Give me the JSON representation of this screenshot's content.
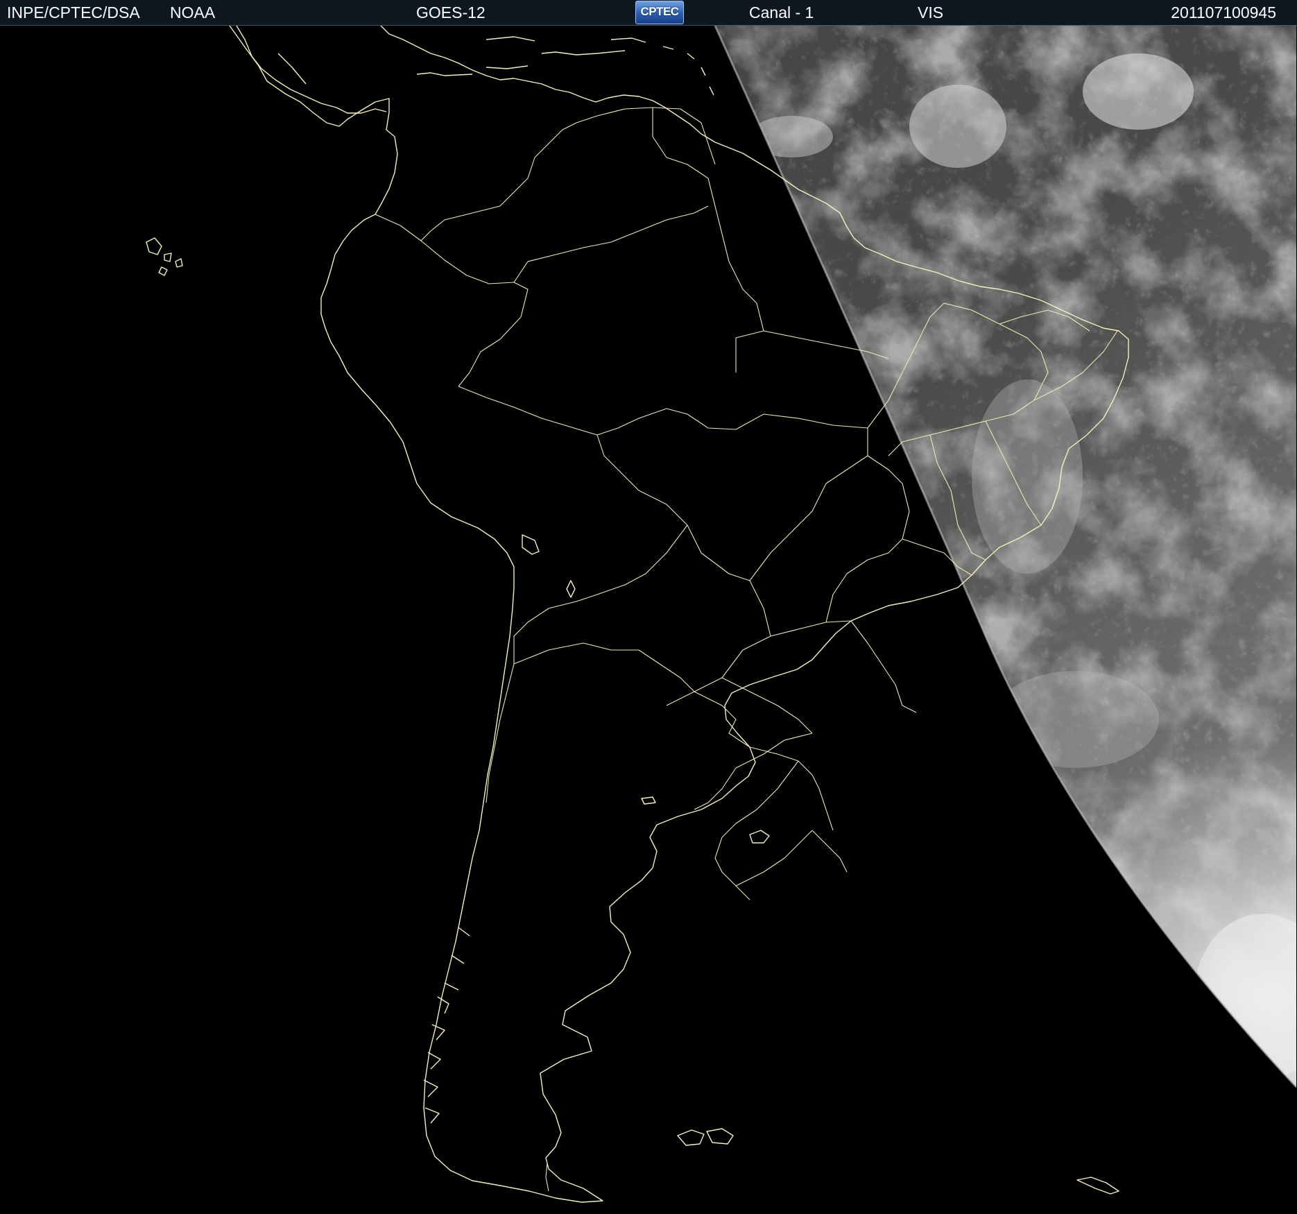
{
  "header": {
    "organization": "INPE/CPTEC/DSA",
    "agency": "NOAA",
    "satellite": "GOES-12",
    "logo_text": "CPTEC",
    "channel": "Canal - 1",
    "band": "VIS",
    "timestamp": "201107100945"
  },
  "image": {
    "subject": "satellite-visible-imagery",
    "night_side_color": "#000000",
    "cloud_colors": [
      "#3c3c3c",
      "#8a8a8a",
      "#e8e8e8"
    ],
    "map_line_color": "#f4f1b8"
  }
}
